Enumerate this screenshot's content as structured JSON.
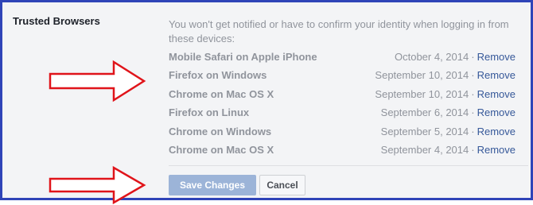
{
  "section": {
    "title": "Trusted Browsers",
    "description": "You won't get notified or have to confirm your identity when logging in from these devices:"
  },
  "devices": [
    {
      "name": "Mobile Safari on Apple iPhone",
      "date": "October 4, 2014",
      "separator": "·",
      "action": "Remove"
    },
    {
      "name": "Firefox on Windows",
      "date": "September 10, 2014",
      "separator": "·",
      "action": "Remove"
    },
    {
      "name": "Chrome on Mac OS X",
      "date": "September 10, 2014",
      "separator": "·",
      "action": "Remove"
    },
    {
      "name": "Firefox on Linux",
      "date": "September 6, 2014",
      "separator": "·",
      "action": "Remove"
    },
    {
      "name": "Chrome on Windows",
      "date": "September 5, 2014",
      "separator": "·",
      "action": "Remove"
    },
    {
      "name": "Chrome on Mac OS X",
      "date": "September 4, 2014",
      "separator": "·",
      "action": "Remove"
    }
  ],
  "buttons": {
    "save": "Save Changes",
    "cancel": "Cancel"
  },
  "colors": {
    "frame_border": "#2f44b8",
    "arrow_stroke": "#e0141a",
    "link": "#365899",
    "save_button": "#9cb4d8"
  },
  "annotations": [
    "arrow-right-icon",
    "arrow-right-icon"
  ]
}
